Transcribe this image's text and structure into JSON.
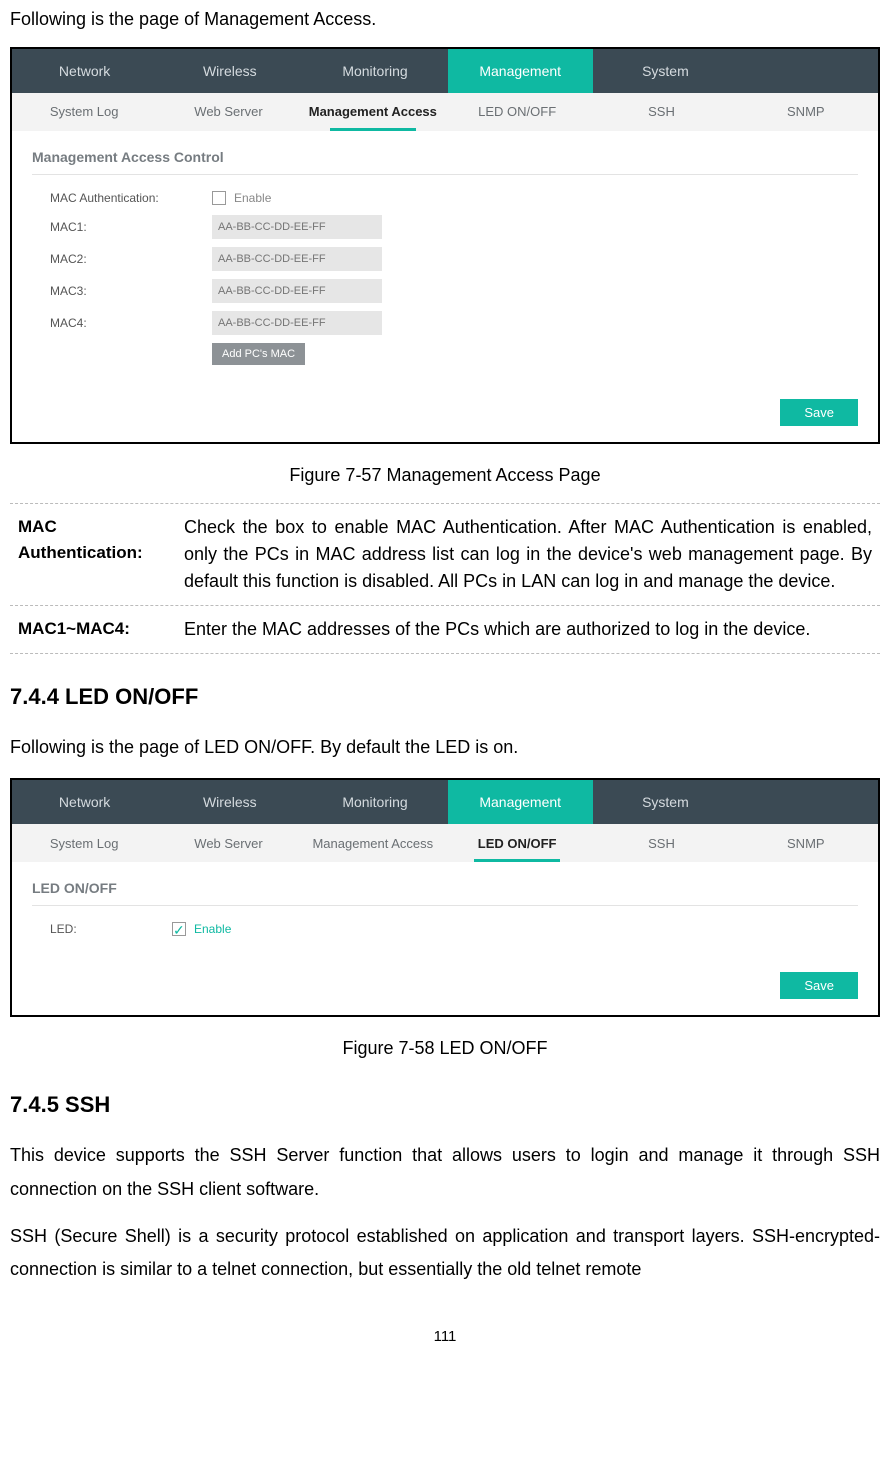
{
  "intro1": "Following is the page of Management Access.",
  "app1": {
    "nav": {
      "items": [
        "Network",
        "Wireless",
        "Monitoring",
        "Management",
        "System"
      ],
      "active_index": 3
    },
    "subnav": {
      "items": [
        "System Log",
        "Web Server",
        "Management Access",
        "LED ON/OFF",
        "SSH",
        "SNMP"
      ],
      "active_index": 2
    },
    "panel_heading": "Management Access Control",
    "rows": {
      "auth_label": "MAC Authentication:",
      "enable_label": "Enable",
      "mac_labels": [
        "MAC1:",
        "MAC2:",
        "MAC3:",
        "MAC4:"
      ],
      "mac_placeholder": "AA-BB-CC-DD-EE-FF",
      "add_btn": "Add PC's MAC"
    },
    "save": "Save"
  },
  "figure1": "Figure 7-57 Management Access Page",
  "defs": {
    "row1_term": "MAC Authentication:",
    "row1_desc": "Check the box to enable MAC Authentication. After MAC Authentication is enabled, only the PCs in MAC address list can log in the device's web management page. By default this function is disabled. All PCs in LAN can log in and manage the device.",
    "row2_term": "MAC1~MAC4:",
    "row2_desc": "Enter the MAC addresses of the PCs which are authorized to log in the device."
  },
  "sec744": "7.4.4  LED ON/OFF",
  "intro2": "Following is the page of LED ON/OFF. By default the LED is on.",
  "app2": {
    "nav": {
      "items": [
        "Network",
        "Wireless",
        "Monitoring",
        "Management",
        "System"
      ],
      "active_index": 3
    },
    "subnav": {
      "items": [
        "System Log",
        "Web Server",
        "Management Access",
        "LED ON/OFF",
        "SSH",
        "SNMP"
      ],
      "active_index": 3
    },
    "panel_heading": "LED ON/OFF",
    "led_label": "LED:",
    "enable_label": "Enable",
    "save": "Save"
  },
  "figure2": "Figure 7-58 LED ON/OFF",
  "sec745": "7.4.5  SSH",
  "ssh_p1": "This device supports the SSH Server function that allows users to login and manage it through SSH connection on the SSH client software.",
  "ssh_p2": "SSH (Secure Shell) is a security protocol established on application and transport layers. SSH-encrypted-connection is similar to a telnet connection, but essentially the old telnet remote",
  "page_number": "111"
}
